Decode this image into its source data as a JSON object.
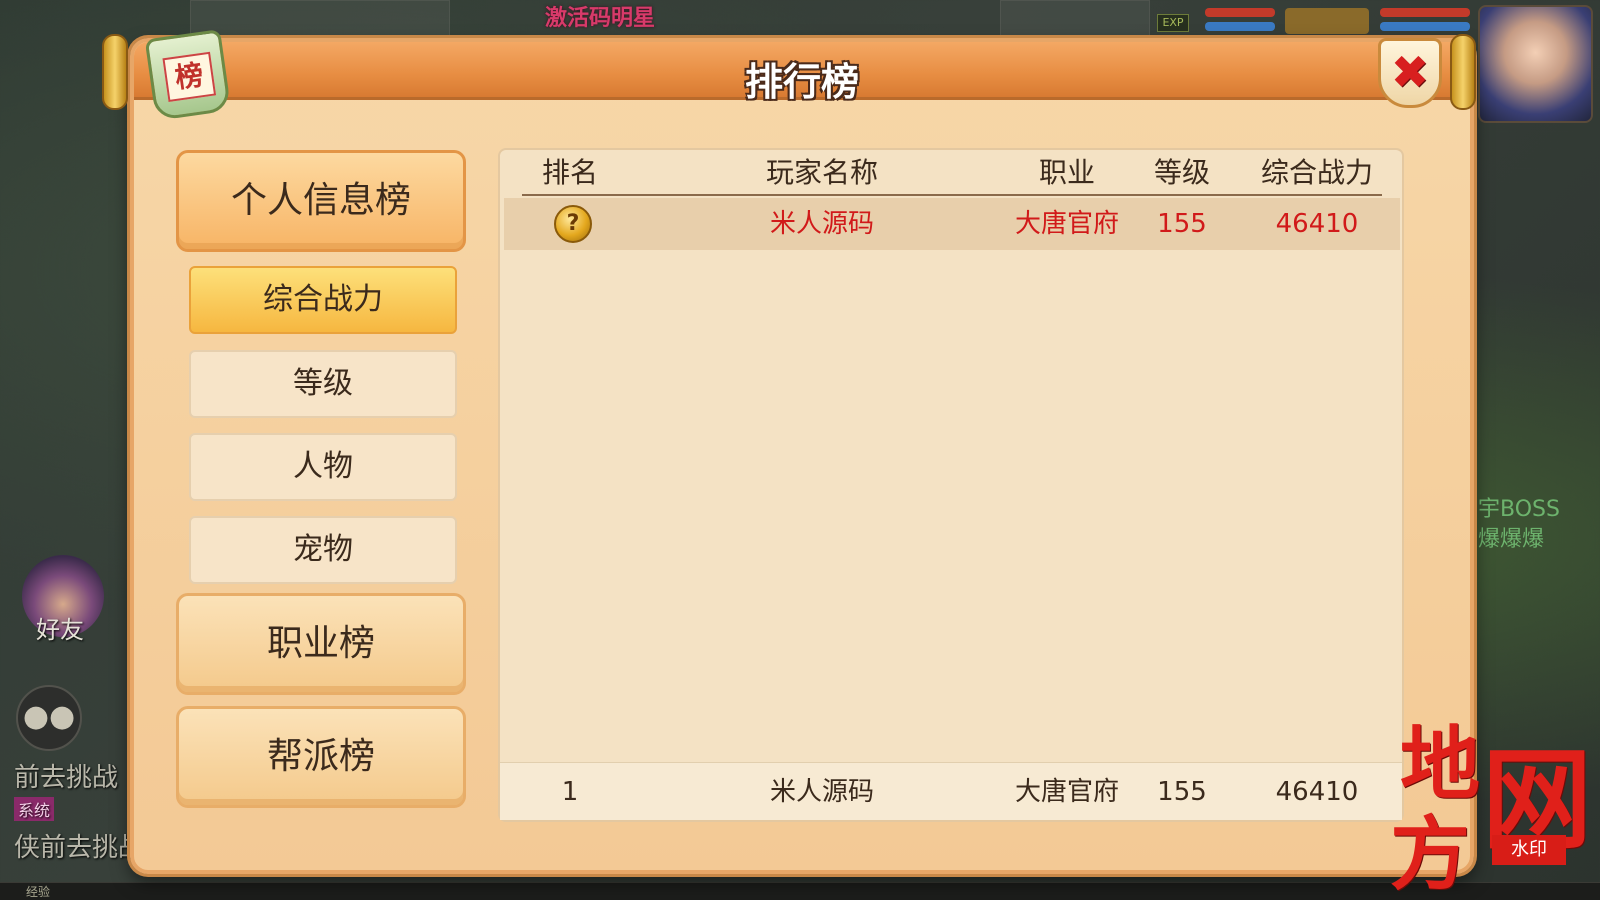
{
  "background": {
    "top_banner": "激活码明星",
    "exp_tag": "EXP",
    "friend_label": "好友",
    "chat_icon": "chat-bubble-icon",
    "side_lines": [
      "前去挑战",
      "侠前去挑战"
    ],
    "system_tag": "系统",
    "right_lines": [
      "宇BOSS",
      "爆爆爆"
    ],
    "bottom_label": "经验"
  },
  "dialog": {
    "title": "排行榜",
    "emblem_char": "榜",
    "close_icon": "close-icon",
    "categories": [
      {
        "label": "个人信息榜",
        "active": true
      },
      {
        "label": "职业榜",
        "active": false
      },
      {
        "label": "帮派榜",
        "active": false
      }
    ],
    "subcategories": [
      {
        "label": "综合战力",
        "active": true
      },
      {
        "label": "等级",
        "active": false
      },
      {
        "label": "人物",
        "active": false
      },
      {
        "label": "宠物",
        "active": false
      }
    ]
  },
  "table": {
    "headers": {
      "rank": "排名",
      "name": "玩家名称",
      "job": "职业",
      "level": "等级",
      "power": "综合战力"
    },
    "rows": [
      {
        "rank_icon": "gold-medal-icon",
        "name": "米人源码",
        "job": "大唐官府",
        "level": "155",
        "power": "46410"
      }
    ],
    "my_rank": {
      "rank": "1",
      "name": "米人源码",
      "job": "大唐官府",
      "level": "155",
      "power": "46410"
    }
  },
  "watermark": {
    "chars": [
      "地",
      "网",
      "方"
    ],
    "stamp": "水印"
  },
  "colors": {
    "title_bar": "#e78d42",
    "panel": "#f4e2c4",
    "highlight_text": "#d11a1a",
    "active_sub": "#f6b740"
  }
}
